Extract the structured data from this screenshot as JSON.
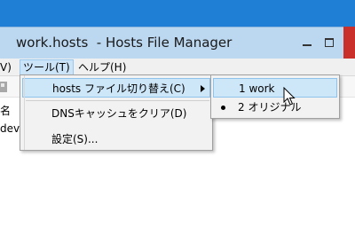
{
  "window": {
    "title": "work.hosts  - Hosts File Manager"
  },
  "menubar": {
    "items": [
      {
        "label": "V)"
      },
      {
        "label": "ツール(T)"
      },
      {
        "label": "ヘルプ(H)"
      }
    ]
  },
  "content": {
    "column_header": "名",
    "row_text": "dev"
  },
  "tools_menu": {
    "items": [
      {
        "label": "hosts ファイル切り替え(C)"
      },
      {
        "label": "DNSキャッシュをクリア(D)"
      },
      {
        "label": "設定(S)..."
      }
    ]
  },
  "switch_submenu": {
    "items": [
      {
        "label": "1 work"
      },
      {
        "label": "2 オリジナル"
      }
    ],
    "checked_item": "2 オリジナル"
  },
  "colors": {
    "highlight": "#cde6f8",
    "titlebar": "#bcd7f0",
    "accent": "#1e7fd4",
    "close": "#c9302c"
  },
  "icons": [
    "minimize-icon",
    "maximize-icon",
    "arrow-right-icon",
    "bullet-icon",
    "cursor-icon"
  ]
}
